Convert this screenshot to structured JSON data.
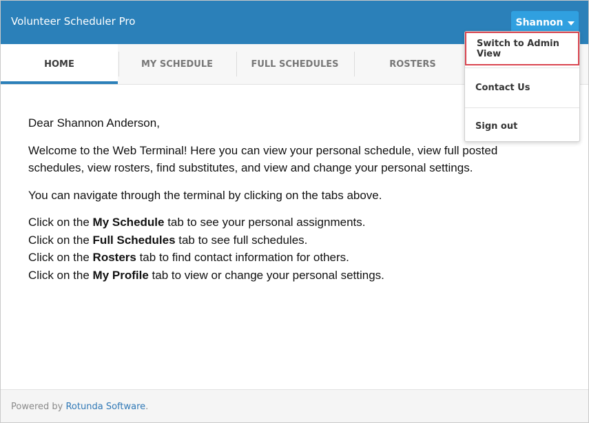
{
  "app": {
    "title": "Volunteer Scheduler Pro"
  },
  "user_menu": {
    "label": "Shannon",
    "items": [
      "Switch to Admin View",
      "Contact Us",
      "Sign out"
    ]
  },
  "tabs": [
    "HOME",
    "MY SCHEDULE",
    "FULL SCHEDULES",
    "ROSTERS"
  ],
  "content": {
    "greeting": "Dear Shannon Anderson,",
    "welcome": "Welcome to the Web Terminal! Here you can view your personal schedule, view full posted schedules, view rosters, find substitutes, and view and change your personal settings.",
    "navigate": "You can navigate through the terminal by clicking on the tabs above.",
    "lines": [
      {
        "pre": "Click on the ",
        "bold": "My Schedule",
        "post": " tab to see your personal assignments."
      },
      {
        "pre": "Click on the ",
        "bold": "Full Schedules",
        "post": " tab to see full schedules."
      },
      {
        "pre": "Click on the ",
        "bold": "Rosters",
        "post": " tab to find contact information for others."
      },
      {
        "pre": "Click on the ",
        "bold": "My Profile",
        "post": " tab to view or change your personal settings."
      }
    ]
  },
  "footer": {
    "prefix": "Powered by ",
    "link": "Rotunda Software",
    "suffix": "."
  },
  "colors": {
    "header": "#2b80b9",
    "user_button": "#30a0e0",
    "highlight": "#d9434e"
  }
}
